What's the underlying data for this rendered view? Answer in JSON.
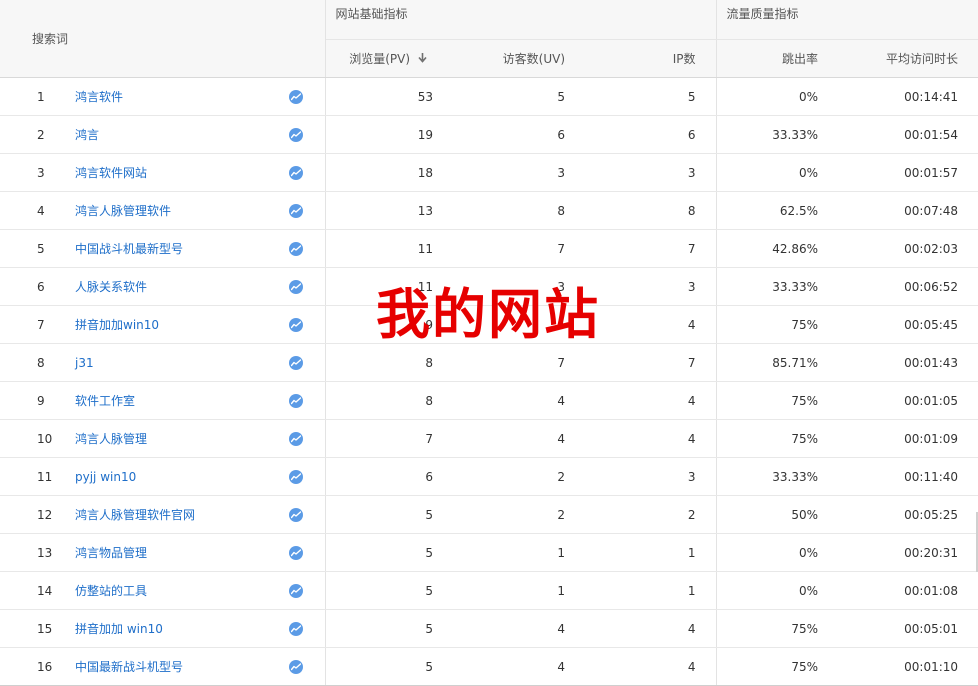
{
  "header": {
    "keyword": "搜索词",
    "group_basic": "网站基础指标",
    "group_quality": "流量质量指标",
    "pv": "浏览量(PV)",
    "uv": "访客数(UV)",
    "ip": "IP数",
    "bounce_rate": "跳出率",
    "avg_duration": "平均访问时长",
    "sort_icon": "arrow-down-icon"
  },
  "rows": [
    {
      "index": "1",
      "keyword": "鸿言软件",
      "pv": "53",
      "uv": "5",
      "ip": "5",
      "bounce_rate": "0%",
      "avg_duration": "00:14:41"
    },
    {
      "index": "2",
      "keyword": "鸿言",
      "pv": "19",
      "uv": "6",
      "ip": "6",
      "bounce_rate": "33.33%",
      "avg_duration": "00:01:54"
    },
    {
      "index": "3",
      "keyword": "鸿言软件网站",
      "pv": "18",
      "uv": "3",
      "ip": "3",
      "bounce_rate": "0%",
      "avg_duration": "00:01:57"
    },
    {
      "index": "4",
      "keyword": "鸿言人脉管理软件",
      "pv": "13",
      "uv": "8",
      "ip": "8",
      "bounce_rate": "62.5%",
      "avg_duration": "00:07:48"
    },
    {
      "index": "5",
      "keyword": "中国战斗机最新型号",
      "pv": "11",
      "uv": "7",
      "ip": "7",
      "bounce_rate": "42.86%",
      "avg_duration": "00:02:03"
    },
    {
      "index": "6",
      "keyword": "人脉关系软件",
      "pv": "11",
      "uv": "3",
      "ip": "3",
      "bounce_rate": "33.33%",
      "avg_duration": "00:06:52"
    },
    {
      "index": "7",
      "keyword": "拼音加加win10",
      "pv": "9",
      "uv": "4",
      "ip": "4",
      "bounce_rate": "75%",
      "avg_duration": "00:05:45"
    },
    {
      "index": "8",
      "keyword": "j31",
      "pv": "8",
      "uv": "7",
      "ip": "7",
      "bounce_rate": "85.71%",
      "avg_duration": "00:01:43"
    },
    {
      "index": "9",
      "keyword": "软件工作室",
      "pv": "8",
      "uv": "4",
      "ip": "4",
      "bounce_rate": "75%",
      "avg_duration": "00:01:05"
    },
    {
      "index": "10",
      "keyword": "鸿言人脉管理",
      "pv": "7",
      "uv": "4",
      "ip": "4",
      "bounce_rate": "75%",
      "avg_duration": "00:01:09"
    },
    {
      "index": "11",
      "keyword": "pyjj win10",
      "pv": "6",
      "uv": "2",
      "ip": "3",
      "bounce_rate": "33.33%",
      "avg_duration": "00:11:40"
    },
    {
      "index": "12",
      "keyword": "鸿言人脉管理软件官网",
      "pv": "5",
      "uv": "2",
      "ip": "2",
      "bounce_rate": "50%",
      "avg_duration": "00:05:25"
    },
    {
      "index": "13",
      "keyword": "鸿言物品管理",
      "pv": "5",
      "uv": "1",
      "ip": "1",
      "bounce_rate": "0%",
      "avg_duration": "00:20:31"
    },
    {
      "index": "14",
      "keyword": "仿整站的工具",
      "pv": "5",
      "uv": "1",
      "ip": "1",
      "bounce_rate": "0%",
      "avg_duration": "00:01:08"
    },
    {
      "index": "15",
      "keyword": "拼音加加 win10",
      "pv": "5",
      "uv": "4",
      "ip": "4",
      "bounce_rate": "75%",
      "avg_duration": "00:05:01"
    },
    {
      "index": "16",
      "keyword": "中国最新战斗机型号",
      "pv": "5",
      "uv": "4",
      "ip": "4",
      "bounce_rate": "75%",
      "avg_duration": "00:01:10"
    }
  ],
  "row_icon": "trend-chart-icon",
  "watermark": "我的网站",
  "colors": {
    "link": "#1e6ec9",
    "trend_icon": "#5b9be6",
    "watermark": "#e60000",
    "header_bg": "#f7f7f7"
  }
}
